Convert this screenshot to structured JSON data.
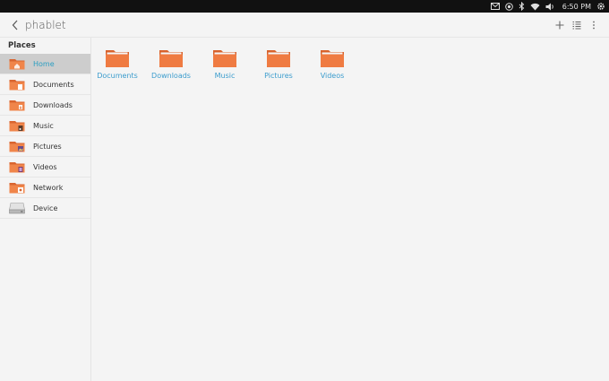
{
  "statusbar": {
    "time": "6:50 PM",
    "icons": [
      "mail-icon",
      "location-icon",
      "bluetooth-icon",
      "wifi-icon",
      "volume-icon",
      "settings-icon"
    ]
  },
  "header": {
    "title": "phablet",
    "actions": [
      "add-icon",
      "list-view-icon",
      "more-icon"
    ]
  },
  "sidebar": {
    "title": "Places",
    "items": [
      {
        "label": "Home",
        "icon": "home-folder-icon",
        "selected": true
      },
      {
        "label": "Documents",
        "icon": "documents-folder-icon"
      },
      {
        "label": "Downloads",
        "icon": "downloads-folder-icon"
      },
      {
        "label": "Music",
        "icon": "music-folder-icon"
      },
      {
        "label": "Pictures",
        "icon": "pictures-folder-icon"
      },
      {
        "label": "Videos",
        "icon": "videos-folder-icon"
      },
      {
        "label": "Network",
        "icon": "network-folder-icon"
      },
      {
        "label": "Device",
        "icon": "drive-icon"
      }
    ]
  },
  "main": {
    "folders": [
      {
        "label": "Documents"
      },
      {
        "label": "Downloads"
      },
      {
        "label": "Music"
      },
      {
        "label": "Pictures"
      },
      {
        "label": "Videos"
      }
    ]
  },
  "colors": {
    "accent": "#2b9ec2",
    "folder": "#e8743b",
    "selected_bg": "#cdcdcd"
  }
}
